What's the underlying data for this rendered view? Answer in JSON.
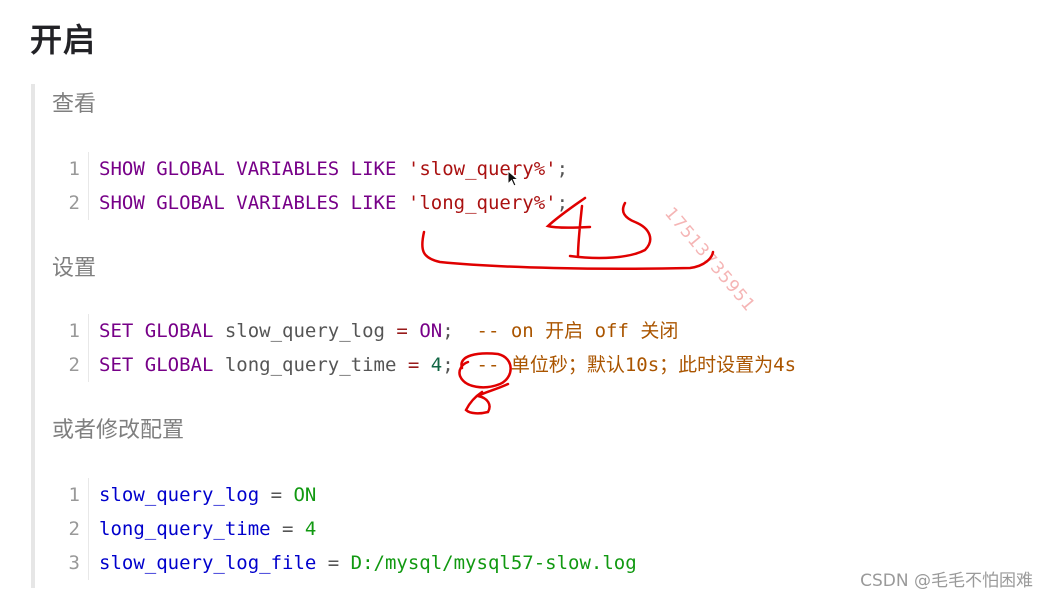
{
  "heading": "开启",
  "sections": [
    {
      "label": "查看",
      "lines": [
        {
          "n": "1",
          "tokens": [
            {
              "t": "SHOW GLOBAL VARIABLES LIKE",
              "c": "kw"
            },
            {
              "t": " ",
              "c": "plain"
            },
            {
              "t": "'slow_query%'",
              "c": "str"
            },
            {
              "t": ";",
              "c": "semi"
            }
          ]
        },
        {
          "n": "2",
          "tokens": [
            {
              "t": "SHOW GLOBAL VARIABLES LIKE",
              "c": "kw"
            },
            {
              "t": " ",
              "c": "plain"
            },
            {
              "t": "'long_query%'",
              "c": "str"
            },
            {
              "t": ";",
              "c": "semi"
            }
          ]
        }
      ]
    },
    {
      "label": "设置",
      "lines": [
        {
          "n": "1",
          "tokens": [
            {
              "t": "SET GLOBAL",
              "c": "kw"
            },
            {
              "t": " slow_query_log ",
              "c": "plain"
            },
            {
              "t": "=",
              "c": "op"
            },
            {
              "t": " ",
              "c": "plain"
            },
            {
              "t": "ON",
              "c": "kw"
            },
            {
              "t": ";",
              "c": "semi"
            },
            {
              "t": "  -- on 开启 off 关闭",
              "c": "cmt"
            }
          ]
        },
        {
          "n": "2",
          "tokens": [
            {
              "t": "SET GLOBAL",
              "c": "kw"
            },
            {
              "t": " long_query_time ",
              "c": "plain"
            },
            {
              "t": "=",
              "c": "op"
            },
            {
              "t": " ",
              "c": "plain"
            },
            {
              "t": "4",
              "c": "num"
            },
            {
              "t": ";",
              "c": "semi"
            },
            {
              "t": "  -- 单位秒；默认10s；此时设置为4s",
              "c": "cmt"
            }
          ]
        }
      ]
    },
    {
      "label": "或者修改配置",
      "lines": [
        {
          "n": "1",
          "tokens": [
            {
              "t": "slow_query_log",
              "c": "var"
            },
            {
              "t": " = ",
              "c": "eq"
            },
            {
              "t": "ON",
              "c": "val"
            }
          ]
        },
        {
          "n": "2",
          "tokens": [
            {
              "t": "long_query_time",
              "c": "var"
            },
            {
              "t": " = ",
              "c": "eq"
            },
            {
              "t": "4",
              "c": "val"
            }
          ]
        },
        {
          "n": "3",
          "tokens": [
            {
              "t": "slow_query_log_file",
              "c": "var"
            },
            {
              "t": " = ",
              "c": "eq"
            },
            {
              "t": "D:/mysql/mysql57-slow.log",
              "c": "val"
            }
          ]
        }
      ]
    }
  ],
  "watermark": "17513735951",
  "credit": "CSDN @毛毛不怕困难",
  "colors": {
    "keyword": "#770088",
    "string": "#aa1111",
    "number": "#116644",
    "comment": "#aa5500",
    "config_key": "#0000cc",
    "config_value": "#119911",
    "annotation": "#e00000"
  }
}
